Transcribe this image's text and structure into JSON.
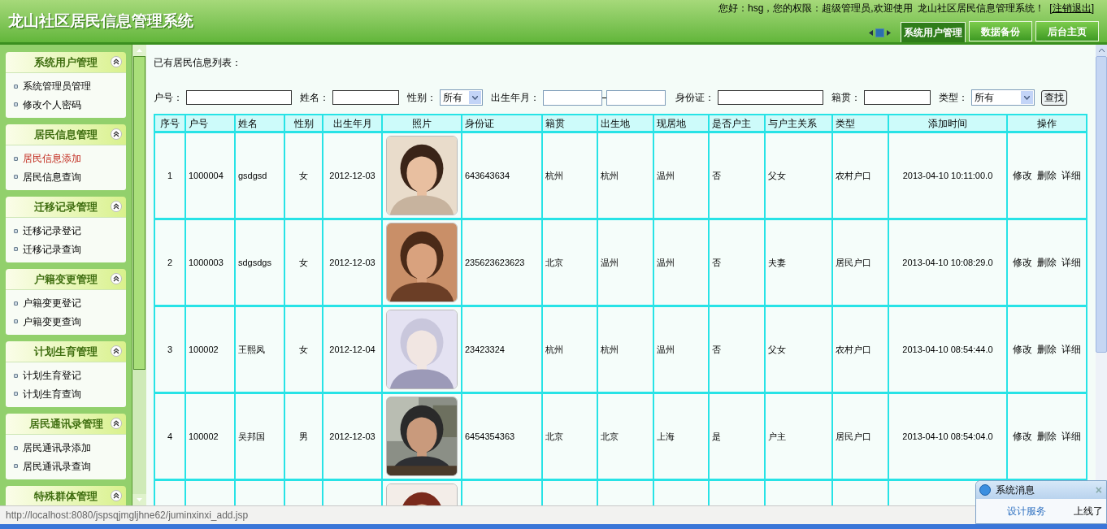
{
  "header": {
    "title": "龙山社区居民信息管理系统",
    "greeting": "您好：hsg，您的权限：超级管理员,欢迎使用  龙山社区居民信息管理系统！",
    "logout": "[注销退出]",
    "tabs": [
      {
        "label": "系统用户管理",
        "selected": true
      },
      {
        "label": "数据备份",
        "selected": false
      },
      {
        "label": "后台主页",
        "selected": false
      }
    ]
  },
  "sidebar": {
    "groups": [
      {
        "title": "系统用户管理",
        "items": [
          {
            "label": "系统管理员管理",
            "selected": false
          },
          {
            "label": "修改个人密码",
            "selected": false
          }
        ]
      },
      {
        "title": "居民信息管理",
        "items": [
          {
            "label": "居民信息添加",
            "selected": true
          },
          {
            "label": "居民信息查询",
            "selected": false
          }
        ]
      },
      {
        "title": "迁移记录管理",
        "items": [
          {
            "label": "迁移记录登记",
            "selected": false
          },
          {
            "label": "迁移记录查询",
            "selected": false
          }
        ]
      },
      {
        "title": "户籍变更管理",
        "items": [
          {
            "label": "户籍变更登记",
            "selected": false
          },
          {
            "label": "户籍变更查询",
            "selected": false
          }
        ]
      },
      {
        "title": "计划生育管理",
        "items": [
          {
            "label": "计划生育登记",
            "selected": false
          },
          {
            "label": "计划生育查询",
            "selected": false
          }
        ]
      },
      {
        "title": "居民通讯录管理",
        "items": [
          {
            "label": "居民通讯录添加",
            "selected": false
          },
          {
            "label": "居民通讯录查询",
            "selected": false
          }
        ]
      },
      {
        "title": "特殊群体管理"
      }
    ]
  },
  "main": {
    "heading": "已有居民信息列表：",
    "filters": [
      {
        "kind": "text",
        "label": "户号："
      },
      {
        "kind": "text",
        "label": "姓名："
      },
      {
        "kind": "select",
        "label": "性别：",
        "value": "所有"
      },
      {
        "kind": "range",
        "label": "出生年月："
      },
      {
        "kind": "text",
        "label": "身份证："
      },
      {
        "kind": "text",
        "label": "籍贯："
      },
      {
        "kind": "select",
        "label": "类型：",
        "value": "所有"
      }
    ],
    "search_button": "查找",
    "table": {
      "columns": [
        "序号",
        "户号",
        "姓名",
        "性别",
        "出生年月",
        "照片",
        "身份证",
        "籍贯",
        "出生地",
        "现居地",
        "是否户主",
        "与户主关系",
        "类型",
        "添加时间",
        "操作"
      ],
      "rows": [
        {
          "cells": [
            "1",
            "1000004",
            "gsdgsd",
            "女",
            "2012-12-03",
            "643643634",
            "杭州",
            "杭州",
            "温州",
            "否",
            "父女",
            "农村户口",
            "2013-04-10 10:11:00.0"
          ],
          "photo": {
            "kind": "picture"
          },
          "actions": [
            "修改",
            "删除",
            "详细"
          ]
        },
        {
          "cells": [
            "2",
            "1000003",
            "sdgsdgs",
            "女",
            "2012-12-03",
            "235623623623",
            "北京",
            "温州",
            "温州",
            "否",
            "夫妻",
            "居民户口",
            "2013-04-10 10:08:29.0"
          ],
          "photo": {
            "kind": "picture"
          },
          "actions": [
            "修改",
            "删除",
            "详细"
          ]
        },
        {
          "cells": [
            "3",
            "100002",
            "王熙凤",
            "女",
            "2012-12-04",
            "23423324",
            "杭州",
            "杭州",
            "温州",
            "否",
            "父女",
            "农村户口",
            "2013-04-10 08:54:44.0"
          ],
          "photo": {
            "kind": "picture"
          },
          "actions": [
            "修改",
            "删除",
            "详细"
          ]
        },
        {
          "cells": [
            "4",
            "100002",
            "吴邦国",
            "男",
            "2012-12-03",
            "6454354363",
            "北京",
            "北京",
            "上海",
            "是",
            "户主",
            "居民户口",
            "2013-04-10 08:54:04.0"
          ],
          "photo": {
            "kind": "picture"
          },
          "actions": [
            "修改",
            "删除",
            "详细"
          ]
        },
        {
          "photo": {
            "kind": "picture"
          }
        }
      ]
    }
  },
  "status_bar": {
    "url": "http://localhost:8080/jspsqjmgljhne62/juminxinxi_add.jsp"
  },
  "popup": {
    "title": "系统消息",
    "link": "设计服务",
    "message": "上线了",
    "close": "×"
  }
}
